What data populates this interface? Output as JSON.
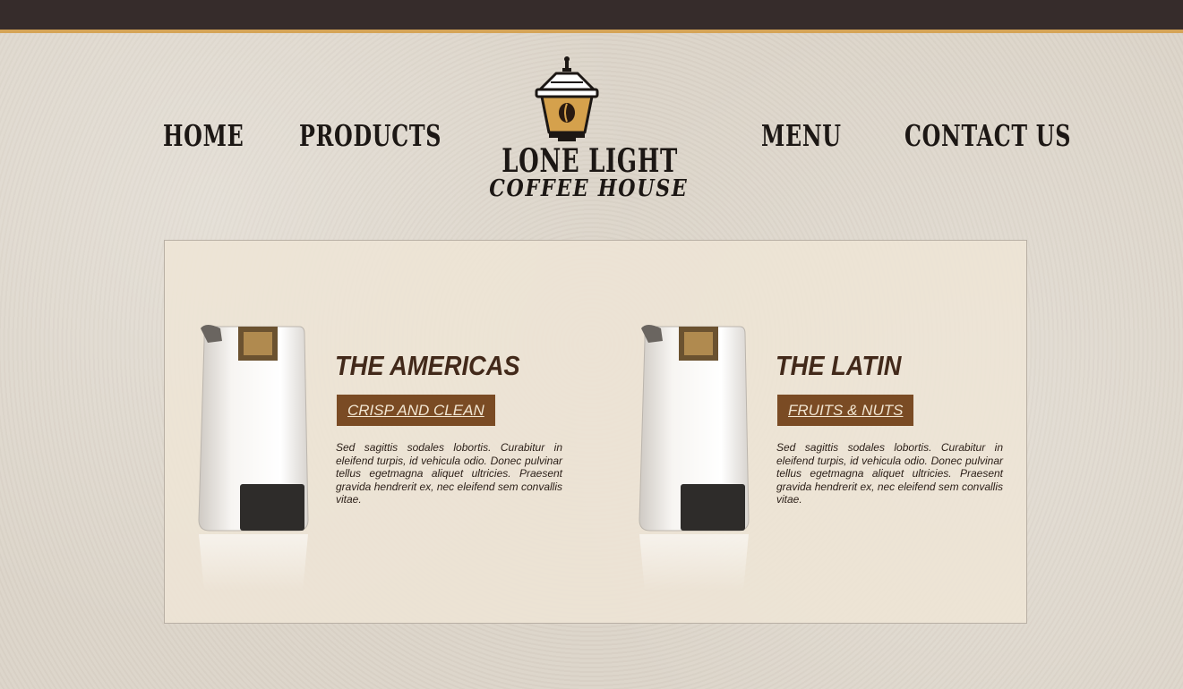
{
  "nav": {
    "home": "HOME",
    "products": "PRODUCTS",
    "menu": "MENU",
    "contact": "CONTACT US"
  },
  "logo": {
    "name": "LONE LIGHT",
    "tagline": "COFFEE HOUSE",
    "icon": "lantern-icon"
  },
  "colors": {
    "topbar": "#362c2b",
    "accent_gold": "#d5a457",
    "title_brown": "#42291a",
    "tag_brown": "#7a4b24"
  },
  "products": [
    {
      "title": "THE AMERICAS",
      "tag": "CRISP AND CLEAN",
      "text": "Sed sagittis sodales lobortis. Curabitur in eleifend turpis, id vehicula odio. Donec pulvinar tellus egetmagna aliquet ultricies. Praesent gravida hendrerit ex, nec eleifend sem convallis vitae."
    },
    {
      "title": "THE LATIN",
      "tag": "FRUITS & NUTS",
      "text": "Sed sagittis sodales lobortis. Curabitur in eleifend turpis, id vehicula odio. Donec pulvinar tellus egetmagna aliquet ultricies. Praesent gravida hendrerit ex, nec eleifend sem convallis vitae."
    }
  ]
}
